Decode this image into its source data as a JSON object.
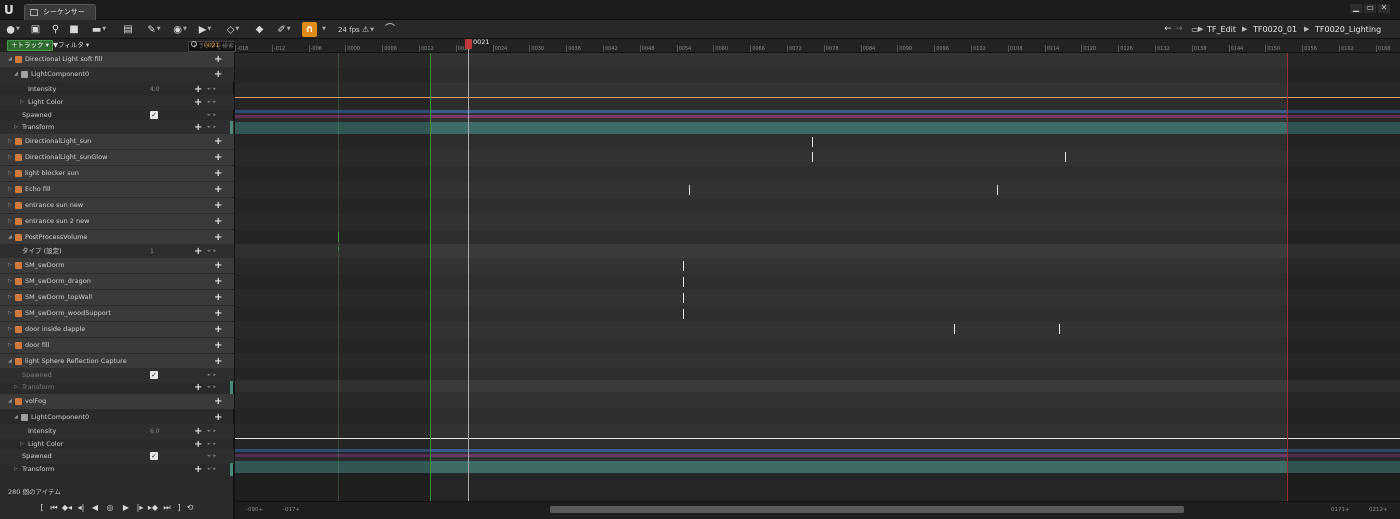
{
  "window": {
    "logo": "U",
    "tab_title": "シーケンサー",
    "controls": [
      "▁",
      "▭",
      "✕"
    ]
  },
  "toolbar": {
    "fps": "24 fps",
    "breadcrumbs": [
      "TF_Edit",
      "TF0020_01",
      "TF0020_Lighting"
    ],
    "snap_icon": "magnet-icon"
  },
  "outliner": {
    "add_track_label": "＋トラック ▾",
    "filter_label": "▼フィルタ ▾",
    "search_placeholder": "トラックを検索",
    "current_frame": "0021",
    "rows": [
      {
        "label": "Directional Light soft fill",
        "indent": 0,
        "type": "actor"
      },
      {
        "label": "LightComponent0",
        "indent": 1,
        "type": "component"
      },
      {
        "label": "Intensity",
        "indent": 2,
        "type": "float",
        "value": "4.0"
      },
      {
        "label": "Light Color",
        "indent": 2,
        "type": "color"
      },
      {
        "label": "Spawned",
        "indent": 1,
        "type": "bool"
      },
      {
        "label": "Transform",
        "indent": 1,
        "type": "transform"
      },
      {
        "label": "DirectionalLight_sun",
        "indent": 0,
        "type": "actor"
      },
      {
        "label": "DirectionalLight_sunGlow",
        "indent": 0,
        "type": "actor"
      },
      {
        "label": "light blocker sun",
        "indent": 0,
        "type": "actor"
      },
      {
        "label": "Echo fill",
        "indent": 0,
        "type": "actor"
      },
      {
        "label": "entrance sun new",
        "indent": 0,
        "type": "actor"
      },
      {
        "label": "entrance sun 2 new",
        "indent": 0,
        "type": "actor"
      },
      {
        "label": "PostProcessVolume",
        "indent": 0,
        "type": "actor"
      },
      {
        "label": "タイプ (設定)",
        "indent": 1,
        "type": "float",
        "value": "1"
      },
      {
        "label": "SM_swDorm",
        "indent": 0,
        "type": "actor"
      },
      {
        "label": "SM_swDorm_dragon",
        "indent": 0,
        "type": "actor"
      },
      {
        "label": "SM_swDorm_topWall",
        "indent": 0,
        "type": "actor"
      },
      {
        "label": "SM_swDorm_woodSupport",
        "indent": 0,
        "type": "actor"
      },
      {
        "label": "door inside dapple",
        "indent": 0,
        "type": "actor"
      },
      {
        "label": "door fill",
        "indent": 0,
        "type": "actor"
      },
      {
        "label": "light Sphere Reflection Capture",
        "indent": 0,
        "type": "actor"
      },
      {
        "label": "Spawned",
        "indent": 1,
        "type": "bool"
      },
      {
        "label": "Transform",
        "indent": 1,
        "type": "transform"
      },
      {
        "label": "volFog",
        "indent": 0,
        "type": "actor"
      },
      {
        "label": "LightComponent0",
        "indent": 1,
        "type": "component"
      },
      {
        "label": "Intensity",
        "indent": 2,
        "type": "float",
        "value": "6.0"
      },
      {
        "label": "Light Color",
        "indent": 2,
        "type": "color"
      },
      {
        "label": "Spawned",
        "indent": 1,
        "type": "bool"
      },
      {
        "label": "Transform",
        "indent": 1,
        "type": "transform"
      }
    ],
    "item_count": "280 個のアイテム"
  },
  "timeline": {
    "playhead_label": "0021",
    "ruler_ticks": [
      "-018",
      "-012",
      "-006",
      "0000",
      "0006",
      "0012",
      "0018",
      "0024",
      "0030",
      "0036",
      "0042",
      "0048",
      "0054",
      "0060",
      "0066",
      "0072",
      "0078",
      "0084",
      "0090",
      "0096",
      "0102",
      "0108",
      "0114",
      "0120",
      "0126",
      "0132",
      "0138",
      "0144",
      "0150",
      "0156",
      "0162",
      "0168"
    ],
    "bottom_left_start": "-090+",
    "bottom_left_end": "-017+",
    "bottom_right_start": "0171+",
    "bottom_right_end": "0212+"
  }
}
